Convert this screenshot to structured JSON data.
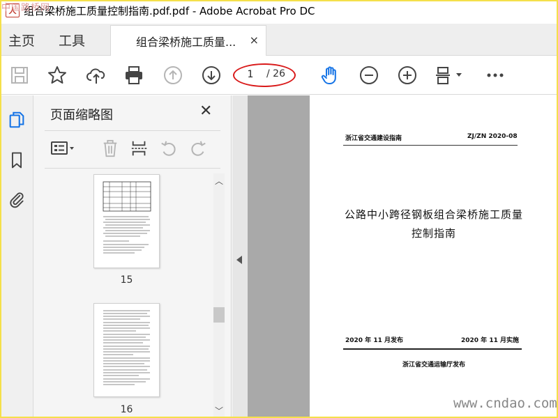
{
  "window": {
    "title": "组合梁桥施工质量控制指南.pdf.pdf - Adobe Acrobat Pro DC",
    "watermark_top": "中国路桥网",
    "watermark_bottom": "www.cndao.com"
  },
  "tabs": {
    "home": "主页",
    "tools": "工具",
    "document": "组合梁桥施工质量...",
    "close": "×"
  },
  "toolbar": {
    "current_page": "1",
    "total_pages": "/ 26",
    "icons": [
      "save-icon",
      "bookmark-star-icon",
      "upload-cloud-icon",
      "print-icon",
      "prev-page-icon",
      "next-page-icon",
      "hand-tool-icon",
      "zoom-out-icon",
      "zoom-in-icon",
      "fit-page-icon",
      "more-icon"
    ],
    "accent_color": "#1473e6",
    "highlight_color": "#d91a1a"
  },
  "sidebar": {
    "panel_title": "页面缩略图",
    "thumbnails": [
      {
        "label": "15"
      },
      {
        "label": "16"
      }
    ]
  },
  "document": {
    "header_left": "浙江省交通建设指南",
    "header_right": "ZJ/ZN 2020-08",
    "title_line1": "公路中小跨径钢板组合梁桥施工质量",
    "title_line2": "控制指南",
    "issue_date": "2020 年 11 月发布",
    "effective_date": "2020 年 11 月实施",
    "publisher": "浙江省交通运输厅发布"
  }
}
